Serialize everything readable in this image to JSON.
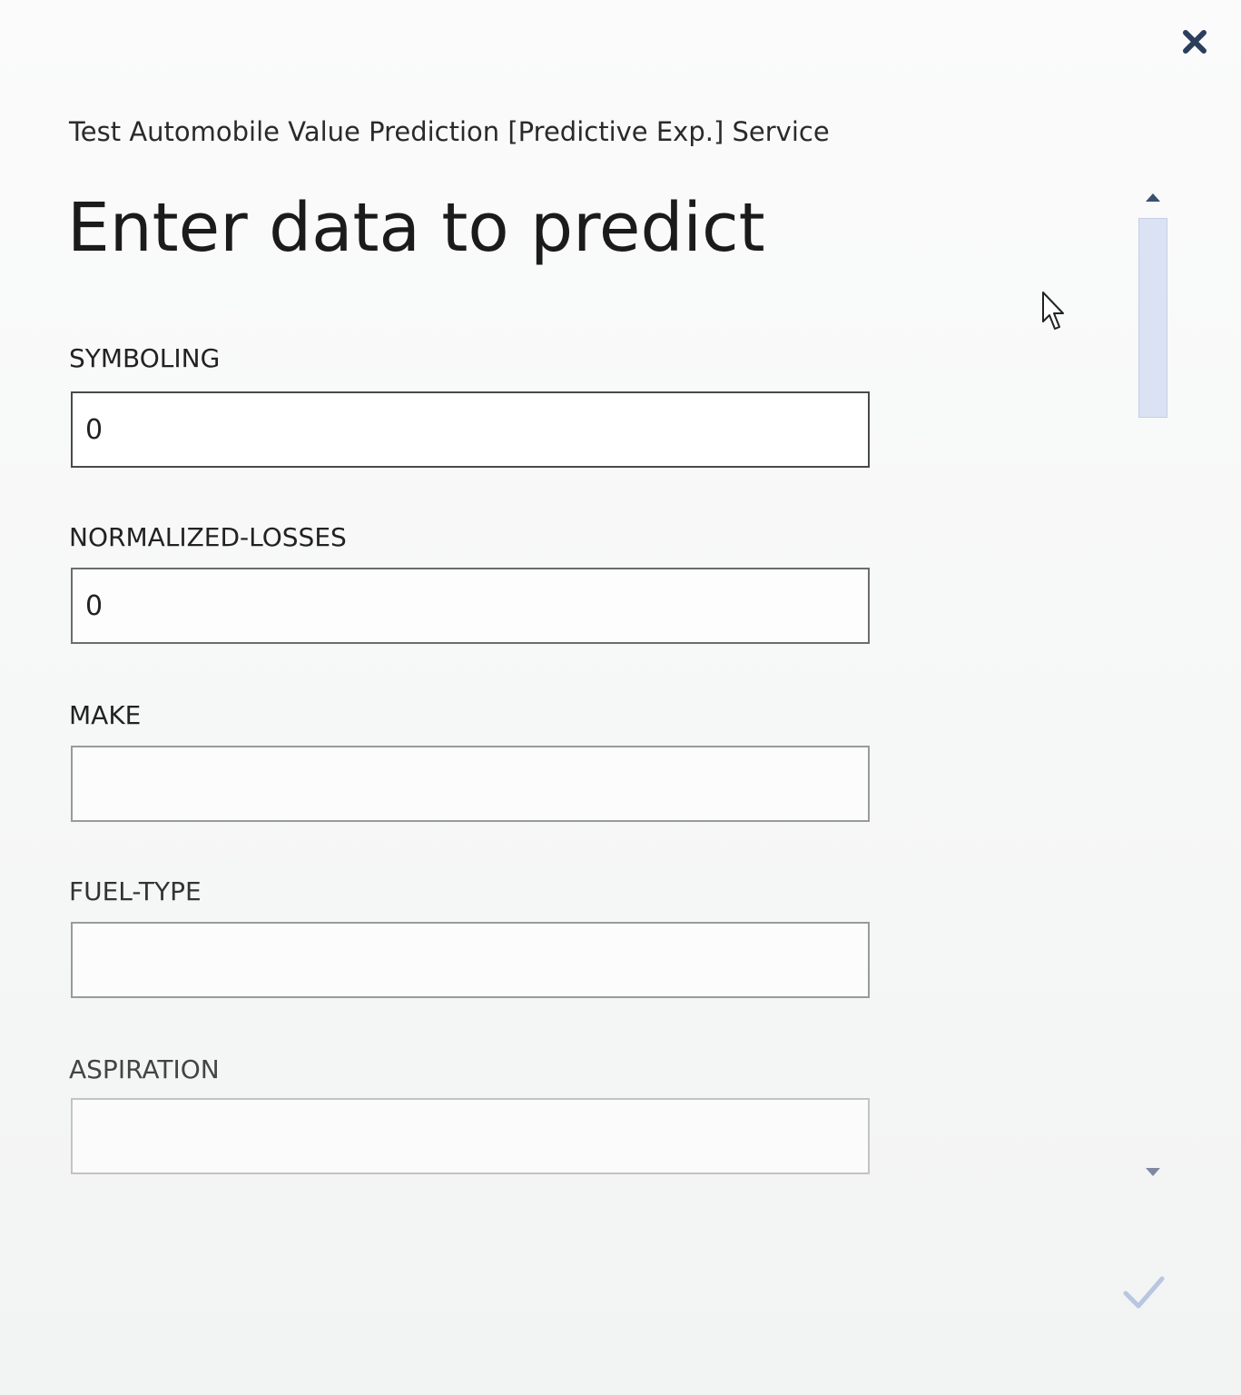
{
  "dialog": {
    "service_title": "Test Automobile Value Prediction [Predictive Exp.] Service",
    "page_title": "Enter data to predict",
    "close_icon": "close-icon",
    "submit_icon": "checkmark-icon"
  },
  "fields": [
    {
      "label": "SYMBOLING",
      "value": "0",
      "placeholder": ""
    },
    {
      "label": "NORMALIZED-LOSSES",
      "value": "0",
      "placeholder": ""
    },
    {
      "label": "MAKE",
      "value": "",
      "placeholder": ""
    },
    {
      "label": "FUEL-TYPE",
      "value": "",
      "placeholder": ""
    },
    {
      "label": "ASPIRATION",
      "value": "",
      "placeholder": ""
    }
  ],
  "scrollbar": {
    "up_icon": "arrow-up-icon",
    "down_icon": "arrow-down-icon"
  },
  "colors": {
    "accent_thumb": "#dbe2f3",
    "close_icon": "#2b3e5c",
    "submit_icon": "#b8c6e0"
  }
}
